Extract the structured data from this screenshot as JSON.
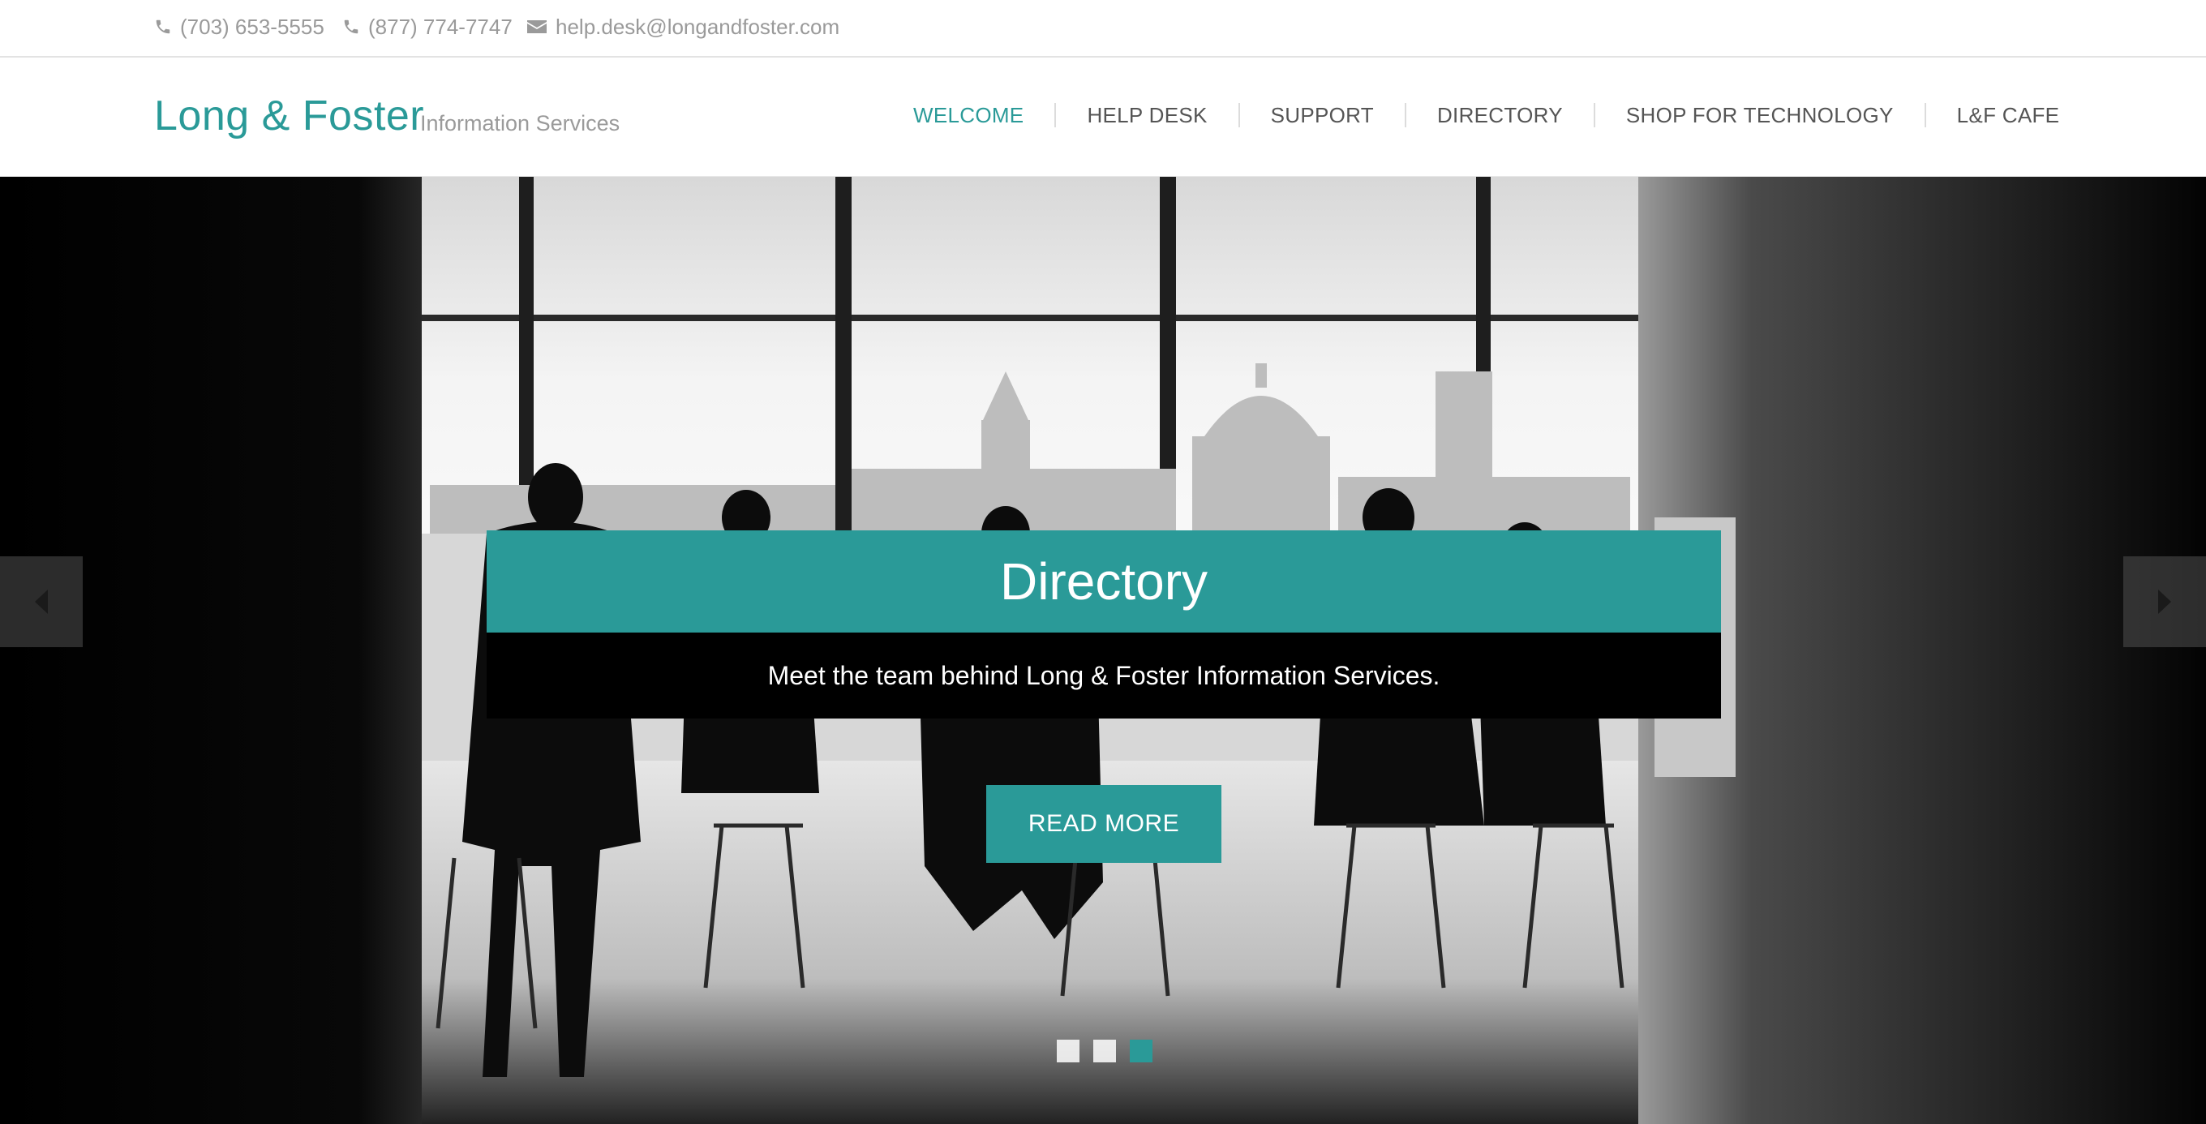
{
  "contact": {
    "phone1": "(703) 653-5555",
    "phone2": "(877) 774-7747",
    "email": "help.desk@longandfoster.com"
  },
  "brand": {
    "name": "Long & Foster",
    "tagline": "Information Services",
    "accent": "#2a9a98"
  },
  "nav": {
    "items": [
      {
        "label": "WELCOME",
        "active": true
      },
      {
        "label": "HELP DESK"
      },
      {
        "label": "SUPPORT"
      },
      {
        "label": "DIRECTORY"
      },
      {
        "label": "SHOP FOR TECHNOLOGY"
      },
      {
        "label": "L&F CAFE"
      }
    ]
  },
  "hero": {
    "title": "Directory",
    "subtitle": "Meet the team behind Long & Foster Information Services.",
    "cta": "READ MORE",
    "slide_count": 3,
    "active_slide": 3
  },
  "icons": {
    "phone": "phone-icon",
    "email": "envelope-icon",
    "prev": "caret-left-icon",
    "next": "caret-right-icon"
  }
}
